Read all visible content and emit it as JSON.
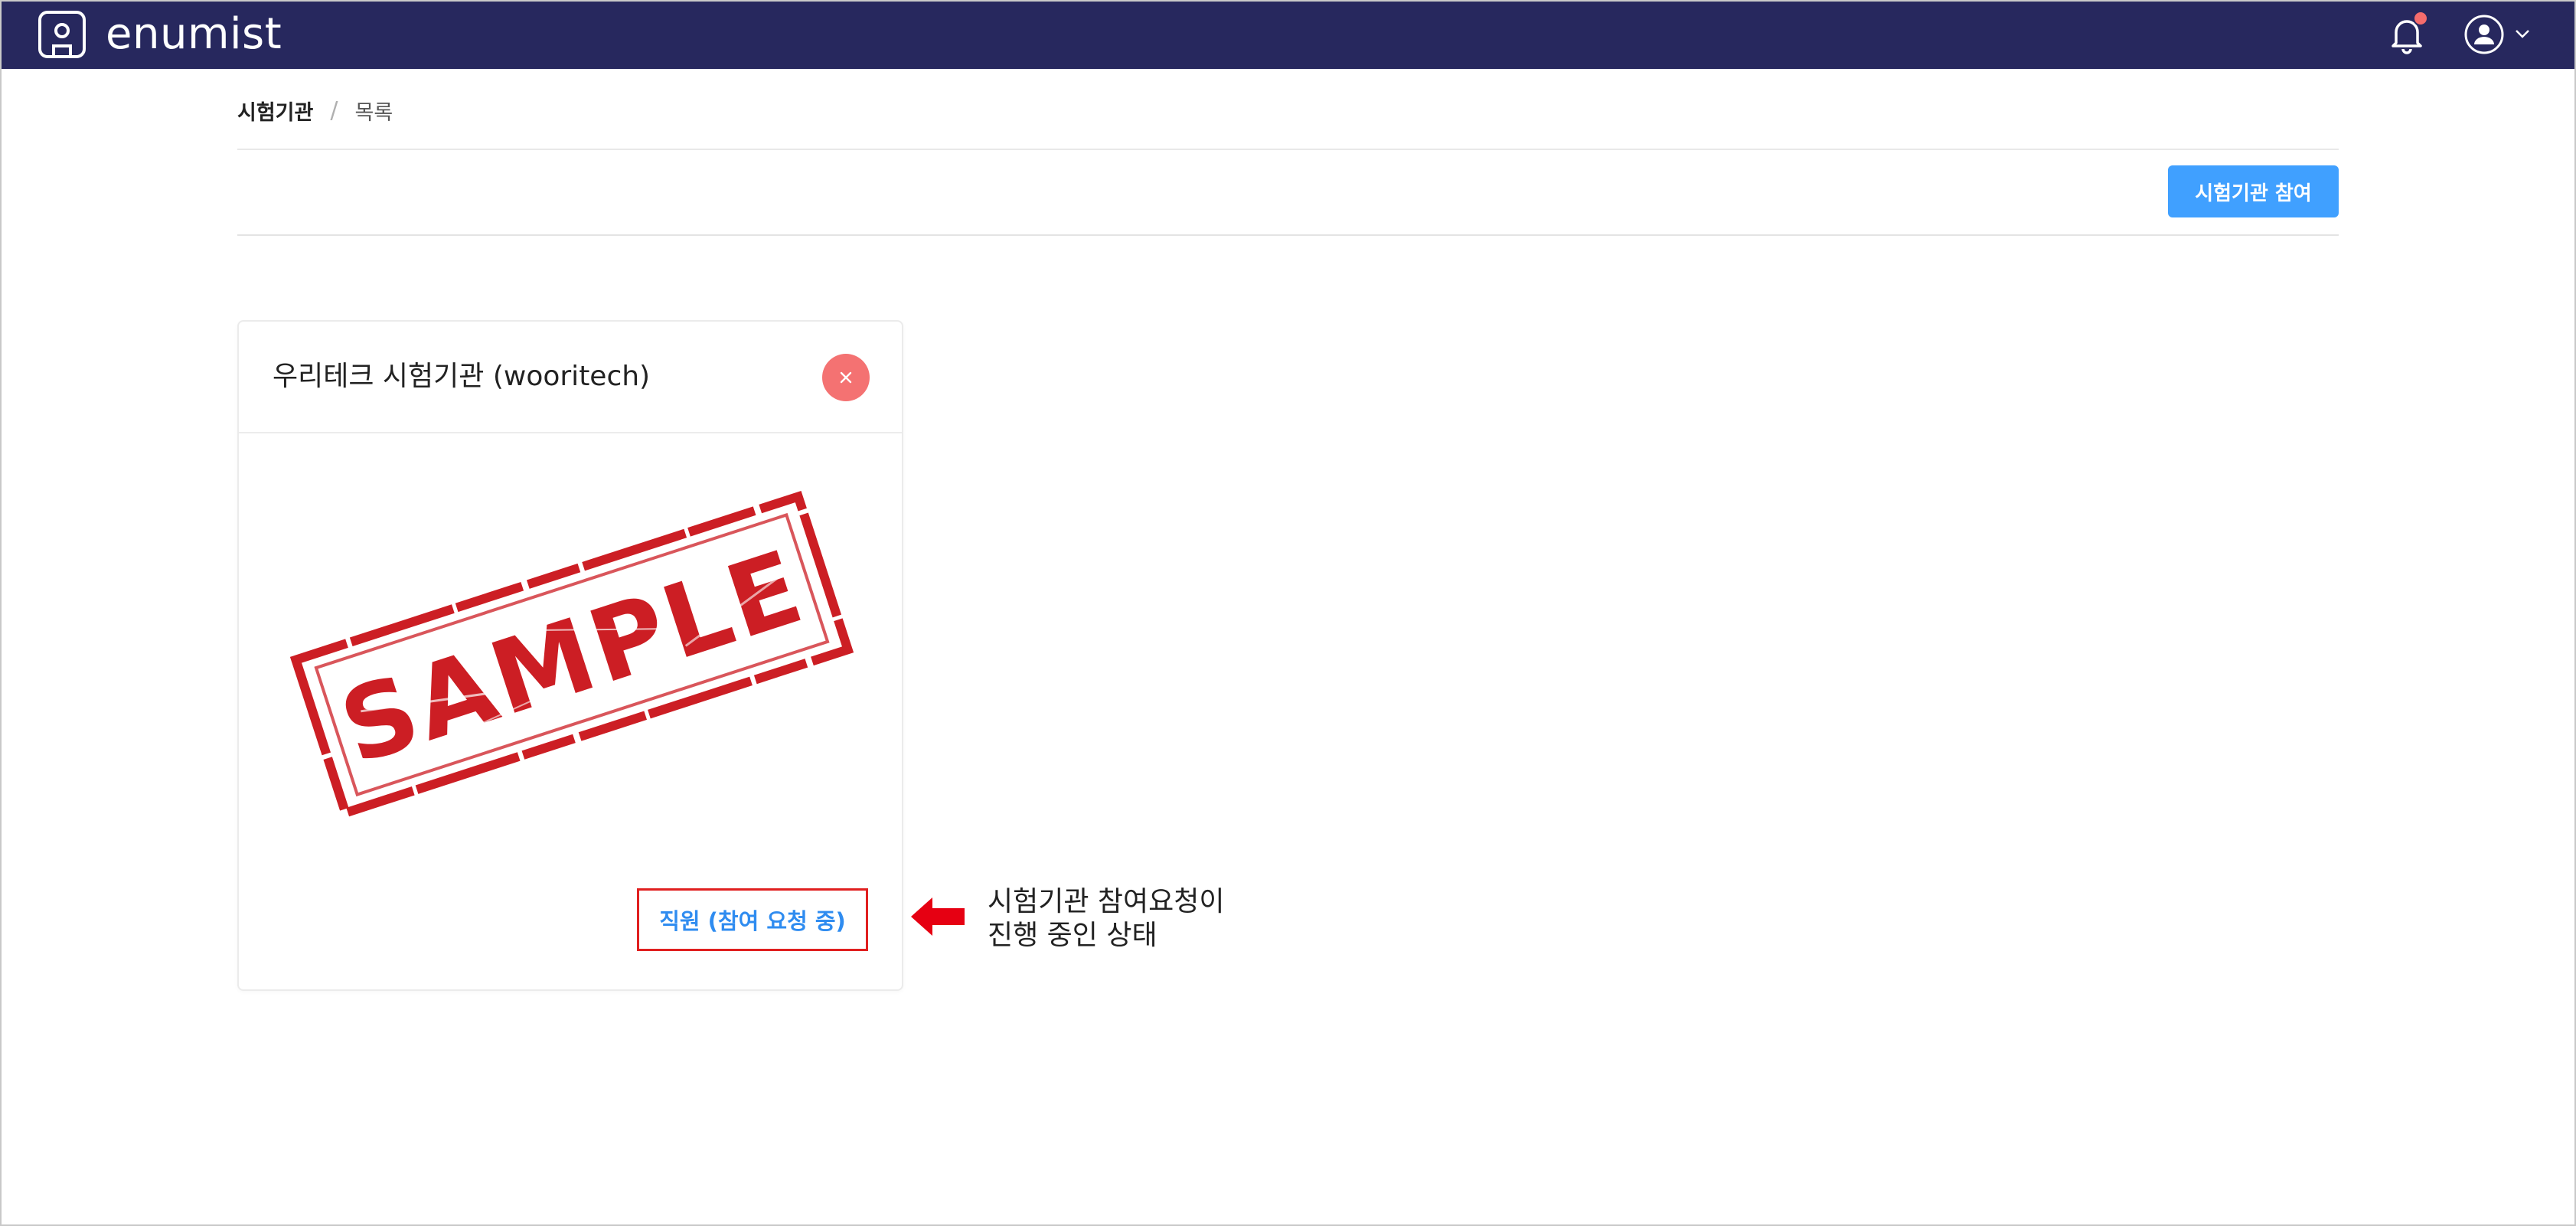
{
  "app": {
    "brand": "enumist",
    "colors": {
      "nav_bg": "#27285e",
      "primary": "#40a0ff",
      "danger": "#f47272",
      "annotation_red": "#e02020"
    }
  },
  "header": {
    "icons": [
      "logo-icon",
      "bell-icon",
      "user-avatar-icon",
      "chevron-down-icon"
    ],
    "notification_badge": true
  },
  "breadcrumb": {
    "home": "시험기관",
    "separator": "/",
    "current": "목록"
  },
  "toolbar": {
    "join_button_label": "시험기관 참여"
  },
  "card": {
    "title": "우리테크 시험기관 (wooritech)",
    "image_text": "SAMPLE",
    "status_label": "직원 (참여 요청 중)",
    "close_icon": "close-icon"
  },
  "annotation": {
    "line1": "시험기관 참여요청이",
    "line2": "진행 중인 상태"
  }
}
